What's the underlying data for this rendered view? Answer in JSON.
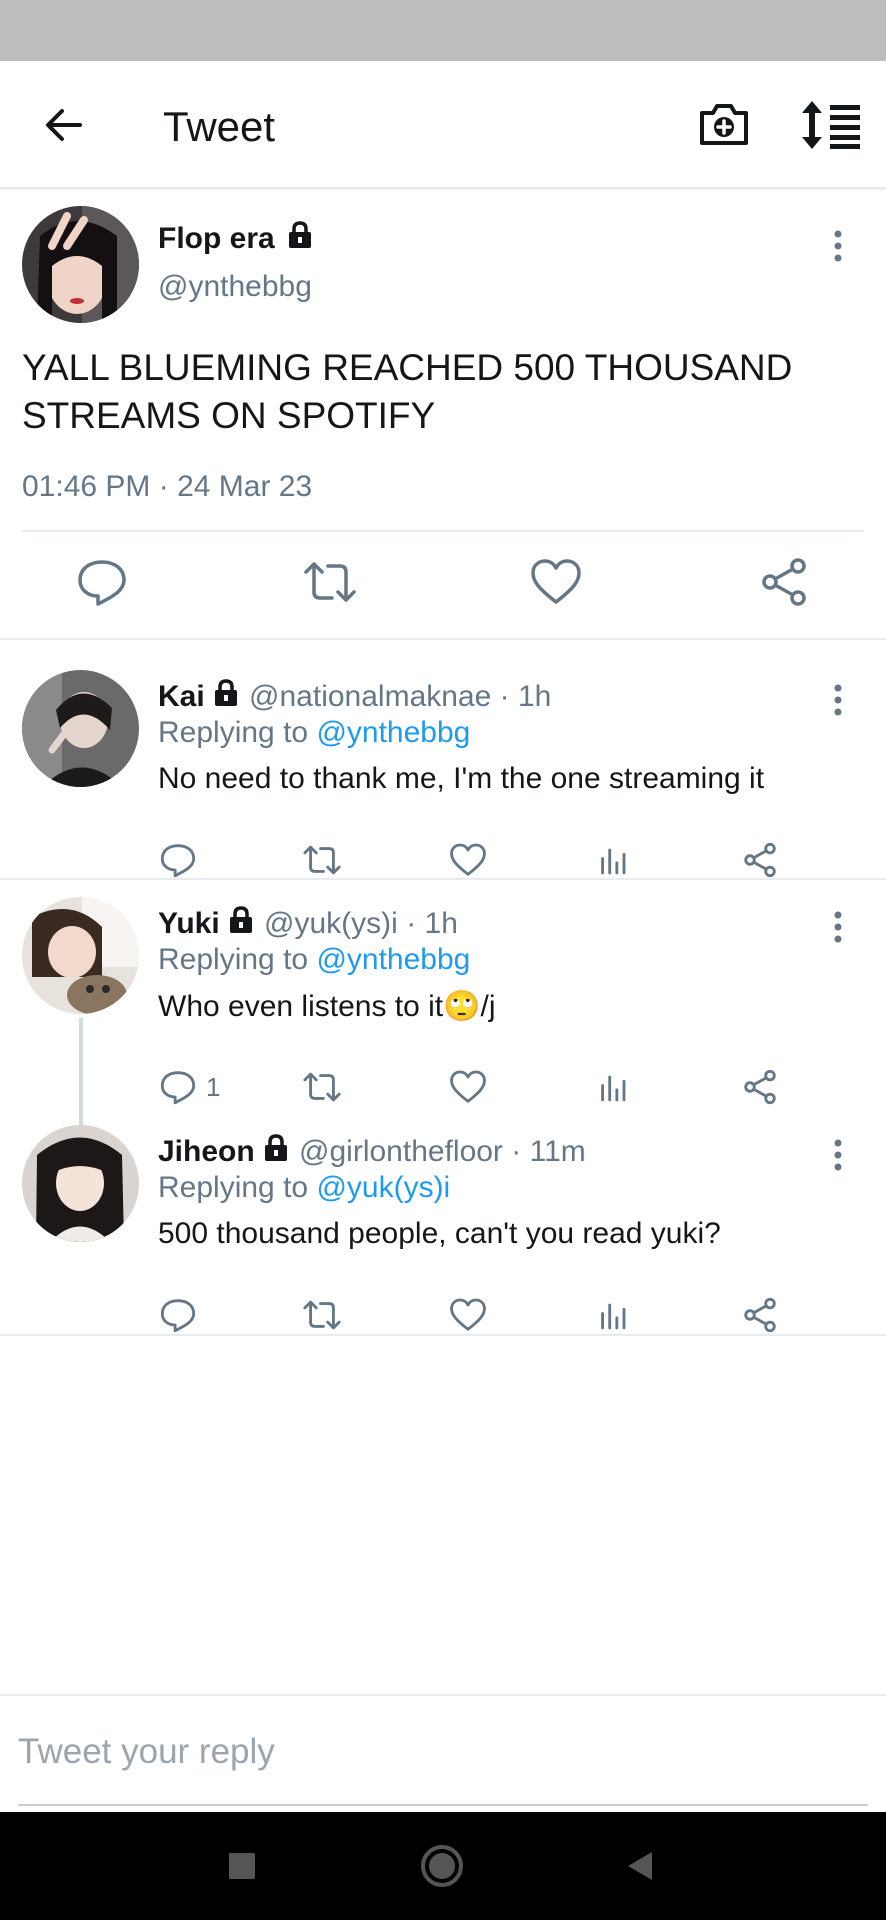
{
  "header": {
    "title": "Tweet",
    "back_icon": "arrow-left-icon",
    "camera_icon": "camera-plus-icon",
    "sort_icon": "sort-list-icon"
  },
  "main_tweet": {
    "display_name": "Flop era",
    "handle": "@ynthebbg",
    "text": "YALL BLUEMING REACHED 500 THOUSAND STREAMS ON SPOTIFY",
    "time": "01:46 PM · 24 Mar 23",
    "locked": true
  },
  "replies": [
    {
      "display_name": "Kai",
      "handle": "@nationalmaknae",
      "time": "· 1h",
      "replying_prefix": "Replying to",
      "replying_to": "@ynthebbg",
      "text": "No need to thank me, I'm the one streaming it",
      "reply_count": ""
    },
    {
      "display_name": "Yuki",
      "handle": "@yuk(ys)i",
      "time": "· 1h",
      "replying_prefix": "Replying to",
      "replying_to": "@ynthebbg",
      "text": "Who even listens to it🙄/j",
      "reply_count": "1"
    },
    {
      "display_name": "Jiheon",
      "handle": "@girlonthefloor",
      "time": "· 11m",
      "replying_prefix": "Replying to",
      "replying_to": "@yuk(ys)i",
      "text": "500 thousand people, can't you read yuki?",
      "reply_count": ""
    }
  ],
  "compose": {
    "placeholder": "Tweet your reply"
  },
  "colors": {
    "link": "#1d9bf0",
    "muted": "#657786",
    "status_bar": "#bdbdbd",
    "nav_bar": "#000000"
  }
}
